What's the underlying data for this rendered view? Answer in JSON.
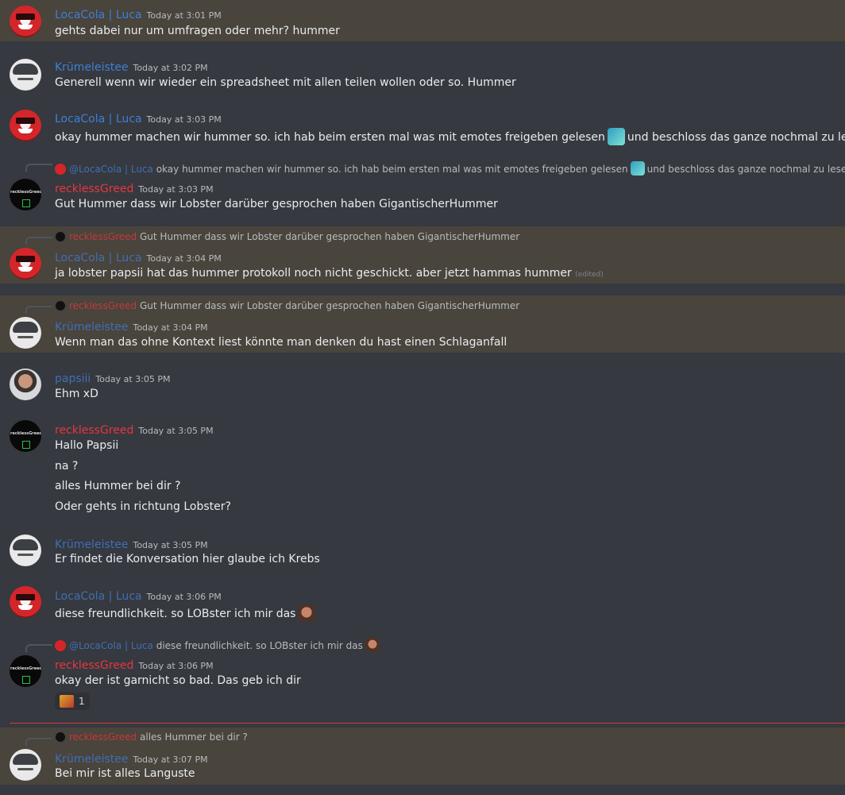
{
  "messages": [
    {
      "author": "LocaCola | Luca",
      "time": "Today at 3:01 PM",
      "text": "gehts dabei nur um umfragen oder mehr? hummer"
    },
    {
      "author": "Krümeleistee",
      "time": "Today at 3:02 PM",
      "text": "Generell wenn wir wieder ein spreadsheet mit allen teilen wollen oder so. Hummer"
    },
    {
      "author": "LocaCola | Luca",
      "time": "Today at 3:03 PM",
      "text_a": "okay hummer machen wir hummer so. ich hab beim ersten mal was mit emotes freigeben gelesen",
      "text_b": "und beschloss das ganze nochmal zu lesen"
    },
    {
      "reply_name": "@LocaCola | Luca",
      "reply_text_a": "okay hummer machen wir hummer so. ich hab beim ersten mal was mit emotes freigeben gelesen",
      "reply_text_b": "und beschloss das ganze nochmal zu lesen",
      "author": "recklessGreed",
      "time": "Today at 3:03 PM",
      "text": "Gut Hummer dass wir Lobster darüber gesprochen haben GigantischerHummer"
    },
    {
      "reply_name": "recklessGreed",
      "reply_text": "Gut Hummer dass wir Lobster darüber gesprochen haben GigantischerHummer",
      "author": "LocaCola | Luca",
      "time": "Today at 3:04 PM",
      "text": "ja lobster papsii hat das hummer protokoll noch nicht geschickt. aber jetzt hammas hummer",
      "edited": "(edited)"
    },
    {
      "reply_name": "recklessGreed",
      "reply_text": "Gut Hummer dass wir Lobster darüber gesprochen haben GigantischerHummer",
      "author": "Krümeleistee",
      "time": "Today at 3:04 PM",
      "text": "Wenn man das ohne Kontext liest könnte man denken du hast einen Schlaganfall"
    },
    {
      "author": "papsiii",
      "time": "Today at 3:05 PM",
      "text": "Ehm xD"
    },
    {
      "author": "recklessGreed",
      "time": "Today at 3:05 PM",
      "lines": [
        "Hallo Papsii",
        "na ?",
        "alles Hummer bei dir ?",
        "Oder gehts in richtung Lobster?"
      ]
    },
    {
      "author": "Krümeleistee",
      "time": "Today at 3:05 PM",
      "text": "Er findet die Konversation hier glaube ich Krebs"
    },
    {
      "author": "LocaCola | Luca",
      "time": "Today at 3:06 PM",
      "text": "diese freundlichkeit. so LOBster ich mir das"
    },
    {
      "reply_name": "@LocaCola | Luca",
      "reply_text": "diese freundlichkeit. so LOBster ich mir das",
      "author": "recklessGreed",
      "time": "Today at 3:06 PM",
      "text": "okay der ist garnicht so bad. Das geb ich dir",
      "reaction_count": "1"
    },
    {
      "reply_name": "recklessGreed",
      "reply_text": "alles Hummer bei dir ?",
      "author": "Krümeleistee",
      "time": "Today at 3:07 PM",
      "text": "Bei mir ist alles Languste"
    }
  ],
  "colors": {
    "background": "#36393f",
    "mention_highlight": "#49443c",
    "author_blue": "#3e7fd6",
    "author_red": "#e5373f",
    "new_divider": "#d83c3e"
  }
}
